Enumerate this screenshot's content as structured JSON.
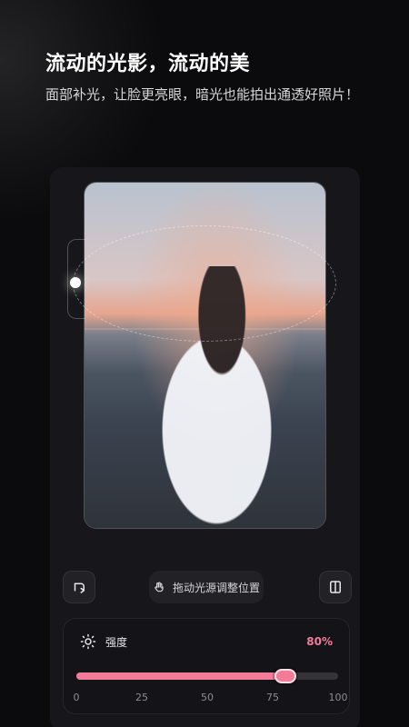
{
  "header": {
    "title": "流动的光影，流动的美",
    "subtitle": "面部补光，让脸更亮眼，暗光也能拍出通透好照片！"
  },
  "controls": {
    "hint": "拖动光源调整位置",
    "icons": {
      "rotate": "rotate-icon",
      "compare": "compare-icon",
      "hand": "hand-icon"
    }
  },
  "strength": {
    "label": "强度",
    "value_text": "80%",
    "value": 80,
    "ticks": [
      "0",
      "25",
      "50",
      "75",
      "100"
    ],
    "accent": "#f27c98"
  }
}
